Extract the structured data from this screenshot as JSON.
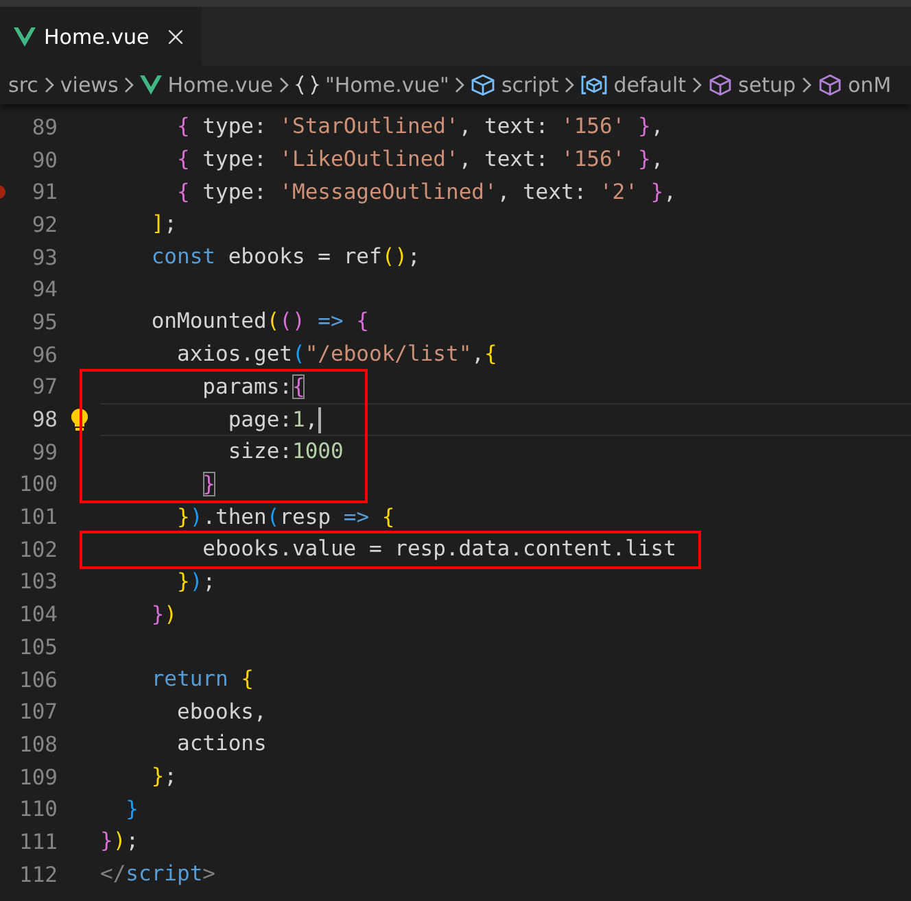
{
  "tabs": [
    {
      "label": "Home.vue",
      "selected": true
    }
  ],
  "breadcrumb": [
    {
      "text": "src",
      "kind": "folder"
    },
    {
      "text": "views",
      "kind": "folder"
    },
    {
      "text": "Home.vue",
      "kind": "vue"
    },
    {
      "text": "\"Home.vue\"",
      "kind": "braces"
    },
    {
      "text": "script",
      "kind": "module"
    },
    {
      "text": "default",
      "kind": "field"
    },
    {
      "text": "setup",
      "kind": "method"
    },
    {
      "text": "onM",
      "kind": "method"
    }
  ],
  "lines": [
    {
      "kind": "line",
      "number": "89",
      "tokens": [
        {
          "text": "      {",
          "kind": "b2"
        },
        {
          "text": " type: ",
          "kind": "plain"
        },
        {
          "text": "'StarOutlined'",
          "kind": "string"
        },
        {
          "text": ", text: ",
          "kind": "plain"
        },
        {
          "text": "'156'",
          "kind": "string"
        },
        {
          "text": " }",
          "kind": "b2"
        },
        {
          "text": ",",
          "kind": "plain"
        }
      ]
    },
    {
      "kind": "line",
      "number": "90",
      "tokens": [
        {
          "text": "      {",
          "kind": "b2"
        },
        {
          "text": " type: ",
          "kind": "plain"
        },
        {
          "text": "'LikeOutlined'",
          "kind": "string"
        },
        {
          "text": ", text: ",
          "kind": "plain"
        },
        {
          "text": "'156'",
          "kind": "string"
        },
        {
          "text": " }",
          "kind": "b2"
        },
        {
          "text": ",",
          "kind": "plain"
        }
      ]
    },
    {
      "kind": "line",
      "number": "91",
      "breakpoint": true,
      "tokens": [
        {
          "text": "      {",
          "kind": "b2"
        },
        {
          "text": " type: ",
          "kind": "plain"
        },
        {
          "text": "'MessageOutlined'",
          "kind": "string"
        },
        {
          "text": ", text: ",
          "kind": "plain"
        },
        {
          "text": "'2'",
          "kind": "string"
        },
        {
          "text": " }",
          "kind": "b2"
        },
        {
          "text": ",",
          "kind": "plain"
        }
      ]
    },
    {
      "kind": "line",
      "number": "92",
      "tokens": [
        {
          "text": "    ]",
          "kind": "b1"
        },
        {
          "text": ";",
          "kind": "plain"
        }
      ]
    },
    {
      "kind": "line",
      "number": "93",
      "tokens": [
        {
          "text": "    const",
          "kind": "keyword"
        },
        {
          "text": " ebooks = ref",
          "kind": "plain"
        },
        {
          "text": "()",
          "kind": "b1"
        },
        {
          "text": ";",
          "kind": "plain"
        }
      ]
    },
    {
      "kind": "line",
      "number": "94"
    },
    {
      "kind": "line",
      "number": "95",
      "tokens": [
        {
          "text": "    onMounted",
          "kind": "plain"
        },
        {
          "text": "(",
          "kind": "b1"
        },
        {
          "text": "()",
          "kind": "b2"
        },
        {
          "text": " =>",
          "kind": "keyword"
        },
        {
          "text": " {",
          "kind": "b2"
        }
      ]
    },
    {
      "kind": "line",
      "number": "96",
      "tokens": [
        {
          "text": "      axios.get",
          "kind": "plain"
        },
        {
          "text": "(",
          "kind": "b3"
        },
        {
          "text": "\"/ebook/list\"",
          "kind": "string"
        },
        {
          "text": ",",
          "kind": "plain"
        },
        {
          "text": "{",
          "kind": "b1"
        }
      ]
    },
    {
      "kind": "highlight",
      "lines": [
        {
          "kind": "line",
          "number": "97",
          "tokens": [
            {
              "text": "        params:",
              "kind": "plain"
            },
            {
              "text": "{",
              "kind": "b2",
              "matched": true
            }
          ]
        },
        {
          "kind": "line",
          "number": "98",
          "current": true,
          "lightbulb": true,
          "tokens": [
            {
              "text": "          page:",
              "kind": "plain"
            },
            {
              "text": "1",
              "kind": "number"
            },
            {
              "text": ",",
              "kind": "plain"
            }
          ]
        },
        {
          "kind": "line",
          "number": "99",
          "tokens": [
            {
              "text": "          size:",
              "kind": "plain"
            },
            {
              "text": "1000",
              "kind": "number"
            }
          ]
        },
        {
          "kind": "line",
          "number": "100",
          "tokens": [
            {
              "text": "        }",
              "kind": "b2",
              "matched": true
            }
          ]
        }
      ]
    },
    {
      "kind": "line",
      "number": "101",
      "tokens": [
        {
          "text": "      }",
          "kind": "b1"
        },
        {
          "text": ")",
          "kind": "b3"
        },
        {
          "text": ".then",
          "kind": "plain"
        },
        {
          "text": "(",
          "kind": "b3"
        },
        {
          "text": "resp ",
          "kind": "plain"
        },
        {
          "text": "=>",
          "kind": "keyword"
        },
        {
          "text": " {",
          "kind": "b1"
        }
      ]
    },
    {
      "kind": "highlight",
      "lines": [
        {
          "kind": "line",
          "number": "102",
          "tokens": [
            {
              "text": "        ebooks.value = resp.data.content.list",
              "kind": "plain"
            }
          ]
        }
      ]
    },
    {
      "kind": "line",
      "number": "103",
      "tokens": [
        {
          "text": "      }",
          "kind": "b1"
        },
        {
          "text": ")",
          "kind": "b3"
        },
        {
          "text": ";",
          "kind": "plain"
        }
      ]
    },
    {
      "kind": "line",
      "number": "104",
      "tokens": [
        {
          "text": "    }",
          "kind": "b2"
        },
        {
          "text": ")",
          "kind": "b1"
        }
      ]
    },
    {
      "kind": "line",
      "number": "105"
    },
    {
      "kind": "line",
      "number": "106",
      "tokens": [
        {
          "text": "    return",
          "kind": "keyword"
        },
        {
          "text": " {",
          "kind": "b1"
        }
      ]
    },
    {
      "kind": "line",
      "number": "107",
      "tokens": [
        {
          "text": "      ebooks,",
          "kind": "plain"
        }
      ]
    },
    {
      "kind": "line",
      "number": "108",
      "tokens": [
        {
          "text": "      actions",
          "kind": "plain"
        }
      ]
    },
    {
      "kind": "line",
      "number": "109",
      "tokens": [
        {
          "text": "    }",
          "kind": "b1"
        },
        {
          "text": ";",
          "kind": "plain"
        }
      ]
    },
    {
      "kind": "line",
      "number": "110",
      "tokens": [
        {
          "text": "  }",
          "kind": "b3"
        }
      ]
    },
    {
      "kind": "line",
      "number": "111",
      "tokens": [
        {
          "text": "}",
          "kind": "b2"
        },
        {
          "text": ")",
          "kind": "b1"
        },
        {
          "text": ";",
          "kind": "plain"
        }
      ]
    },
    {
      "kind": "line",
      "number": "112",
      "tokens": [
        {
          "text": "</",
          "kind": "tag"
        },
        {
          "text": "script",
          "kind": "keyword"
        },
        {
          "text": ">",
          "kind": "tag"
        }
      ]
    }
  ]
}
